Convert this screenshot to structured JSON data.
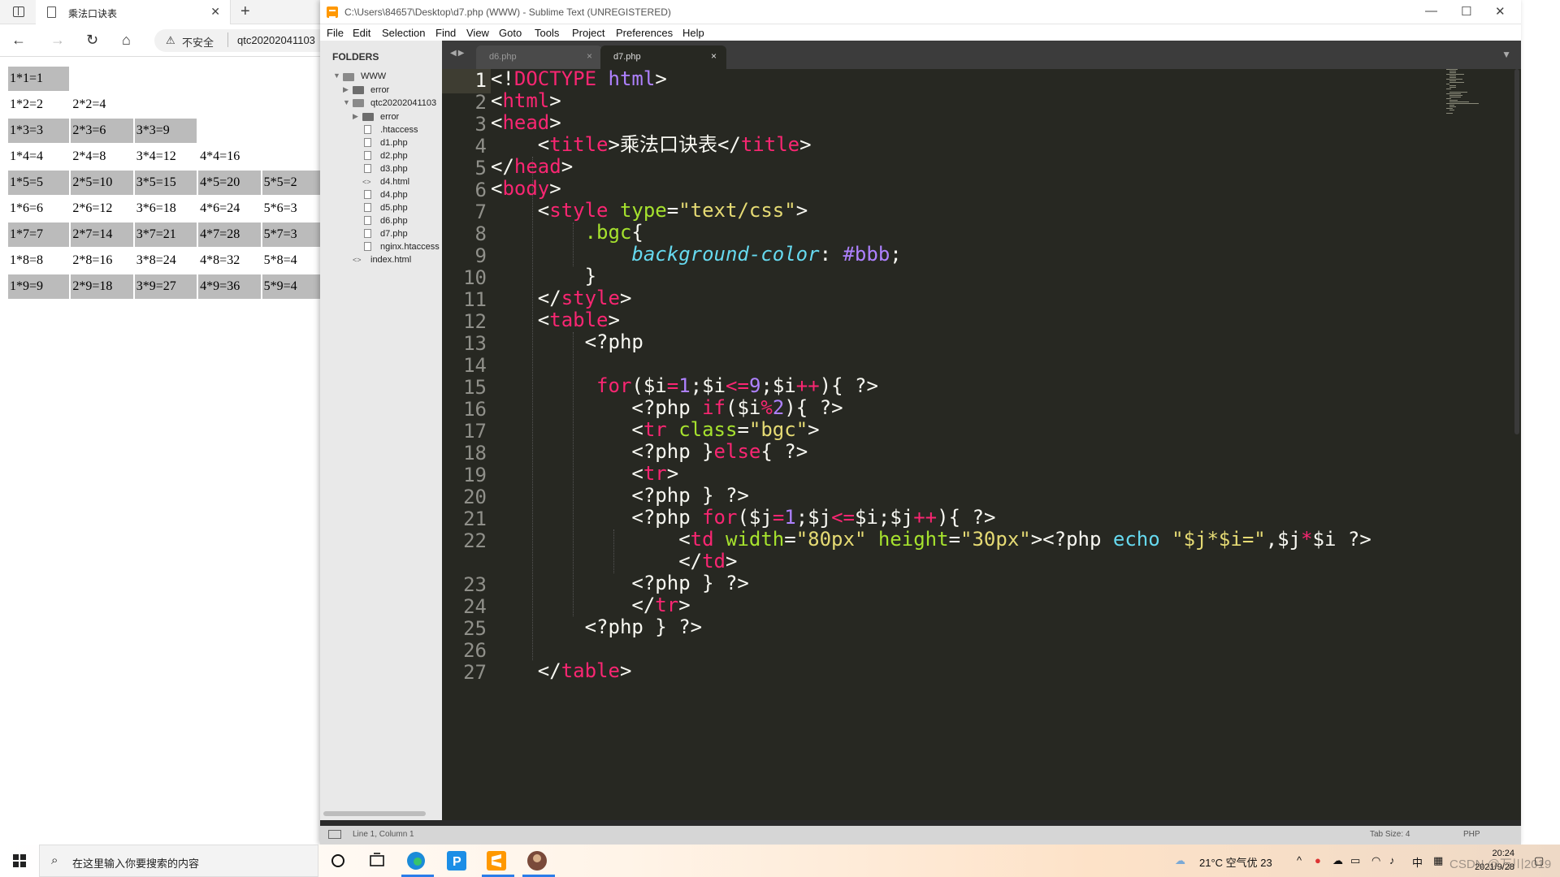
{
  "browser": {
    "tab_title": "乘法口诀表",
    "tab_close": "✕",
    "new_tab": "+",
    "insecure_label": "不安全",
    "url": "qtc20202041103",
    "table": [
      [
        "1*1=1"
      ],
      [
        "1*2=2",
        "2*2=4"
      ],
      [
        "1*3=3",
        "2*3=6",
        "3*3=9"
      ],
      [
        "1*4=4",
        "2*4=8",
        "3*4=12",
        "4*4=16"
      ],
      [
        "1*5=5",
        "2*5=10",
        "3*5=15",
        "4*5=20",
        "5*5=2"
      ],
      [
        "1*6=6",
        "2*6=12",
        "3*6=18",
        "4*6=24",
        "5*6=3"
      ],
      [
        "1*7=7",
        "2*7=14",
        "3*7=21",
        "4*7=28",
        "5*7=3"
      ],
      [
        "1*8=8",
        "2*8=16",
        "3*8=24",
        "4*8=32",
        "5*8=4"
      ],
      [
        "1*9=9",
        "2*9=18",
        "3*9=27",
        "4*9=36",
        "5*9=4"
      ]
    ],
    "row_shade_color": "#bbbbbb"
  },
  "sublime": {
    "title": "C:\\Users\\84657\\Desktop\\d7.php (WWW) - Sublime Text (UNREGISTERED)",
    "menu": [
      "File",
      "Edit",
      "Selection",
      "Find",
      "View",
      "Goto",
      "Tools",
      "Project",
      "Preferences",
      "Help"
    ],
    "sidebar": {
      "header": "FOLDERS",
      "items": [
        "WWW",
        "error",
        "qtc20202041103",
        "error",
        ".htaccess",
        "d1.php",
        "d2.php",
        "d3.php",
        "d4.html",
        "d4.php",
        "d5.php",
        "d6.php",
        "d7.php",
        "nginx.htaccess",
        "index.html"
      ]
    },
    "tabs": [
      {
        "label": "d6.php",
        "active": false
      },
      {
        "label": "d7.php",
        "active": true
      }
    ],
    "tab_close": "×",
    "line_numbers": [
      "1",
      "2",
      "3",
      "4",
      "5",
      "6",
      "7",
      "8",
      "9",
      "10",
      "11",
      "12",
      "13",
      "14",
      "15",
      "16",
      "17",
      "18",
      "19",
      "20",
      "21",
      "22",
      "23",
      "24",
      "25",
      "26",
      "27"
    ],
    "status": {
      "position": "Line 1, Column 1",
      "tab_size": "Tab Size: 4",
      "syntax": "PHP"
    },
    "theme_colors": {
      "bg": "#272822",
      "tag": "#f92672",
      "attr": "#a6e22e",
      "string": "#e6db74",
      "number": "#ae81ff"
    }
  },
  "taskbar": {
    "search_placeholder": "在这里输入你要搜索的内容",
    "weather": "21°C  空气优 23",
    "ime": "中",
    "time": "20:24",
    "date": "2021/9/28",
    "watermark": "CSDN @万川2019",
    "icons": [
      "search-icon",
      "task-view-icon",
      "edge-icon",
      "p-app-icon",
      "sublime-icon",
      "avatar-app-icon"
    ]
  }
}
